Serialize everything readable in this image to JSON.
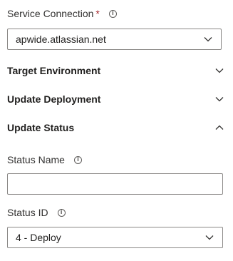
{
  "service_connection": {
    "label": "Service Connection",
    "required_mark": "*",
    "selected_value": "apwide.atlassian.net"
  },
  "sections": {
    "target_environment": "Target Environment",
    "update_deployment": "Update Deployment",
    "update_status": "Update Status"
  },
  "status_name": {
    "label": "Status Name",
    "value": ""
  },
  "status_id": {
    "label": "Status ID",
    "selected_value": "4 - Deploy"
  },
  "icons": {
    "info": "info-icon",
    "chevron_down": "chevron-down-icon",
    "chevron_up": "chevron-up-icon"
  },
  "colors": {
    "required": "#a4262c",
    "border": "#8a8886",
    "text": "#323130"
  }
}
